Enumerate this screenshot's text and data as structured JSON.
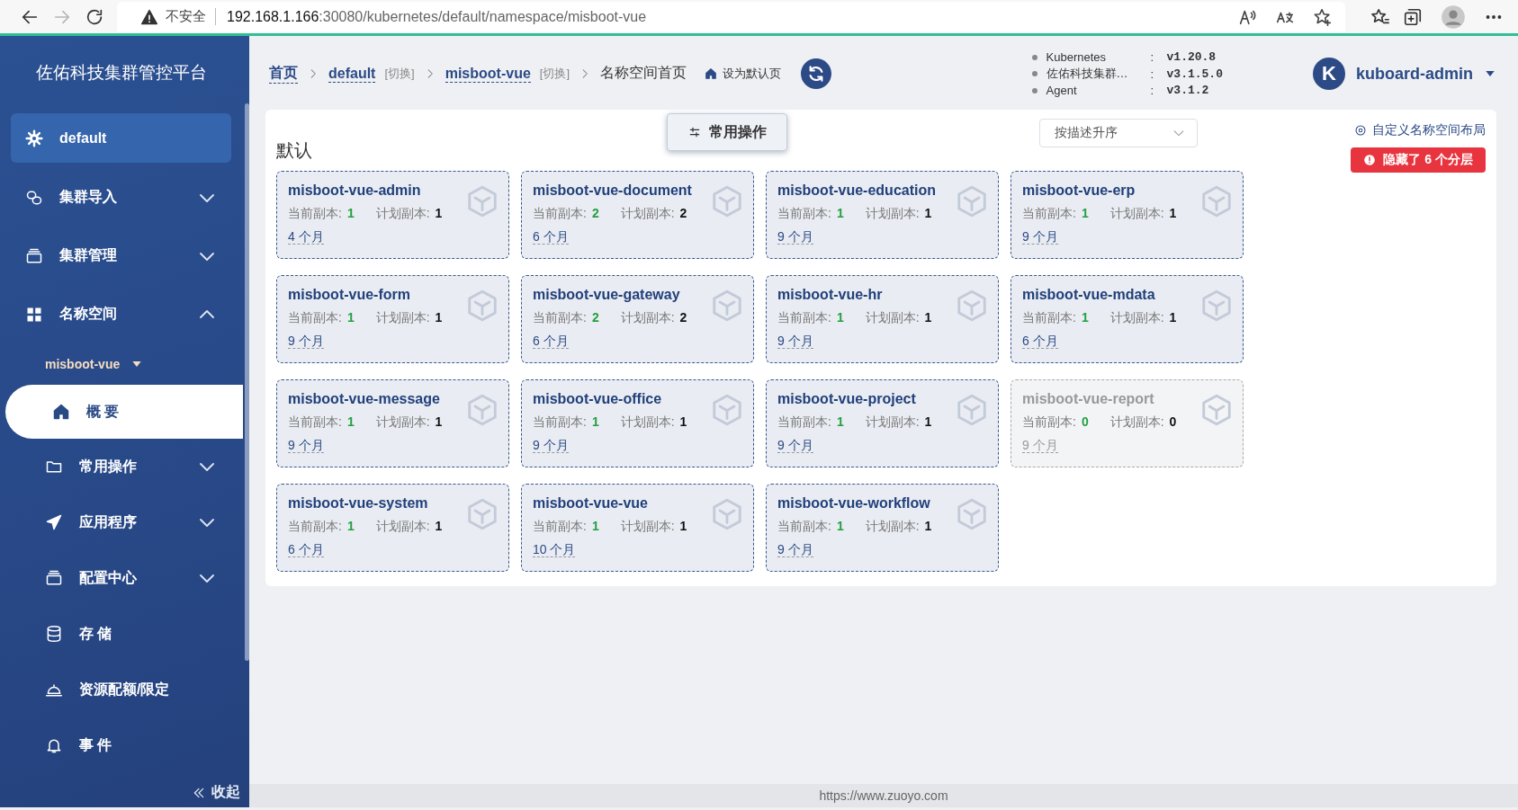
{
  "browser": {
    "security": "不安全",
    "url_host": "192.168.1.166",
    "url_rest": ":30080/kubernetes/default/namespace/misboot-vue"
  },
  "sidebar": {
    "title": "佐佑科技集群管控平台",
    "items": [
      {
        "label": "default",
        "selected": true
      },
      {
        "label": "集群导入",
        "expanded": false,
        "selected": false
      },
      {
        "label": "集群管理",
        "expanded": false,
        "selected": false
      },
      {
        "label": "名称空间",
        "expanded": true,
        "selected": false,
        "namespace": "misboot-vue",
        "children": [
          {
            "label": "概 要",
            "selected": true
          },
          {
            "label": "常用操作",
            "expanded": false,
            "selected": false
          },
          {
            "label": "应用程序",
            "expanded": false,
            "selected": false
          },
          {
            "label": "配置中心",
            "expanded": false,
            "selected": false
          },
          {
            "label": "存 储",
            "selected": false
          },
          {
            "label": "资源配额/限定",
            "selected": false
          },
          {
            "label": "事 件",
            "selected": false
          }
        ]
      }
    ],
    "collapse": "收起"
  },
  "breadcrumb": {
    "items": [
      {
        "label": "首页",
        "current": false
      },
      {
        "label": "default",
        "switch": "[切换]",
        "current": false
      },
      {
        "label": "misboot-vue",
        "switch": "[切换]",
        "current": false
      },
      {
        "label": "名称空间首页",
        "current": true
      }
    ],
    "set_default": "设为默认页"
  },
  "versions": [
    {
      "name": "Kubernetes",
      "separator": ":",
      "value": "v1.20.8"
    },
    {
      "name": "佐佑科技集群…",
      "separator": ":",
      "value": "v3.1.5.0"
    },
    {
      "name": "Agent",
      "separator": ":",
      "value": "v3.1.2"
    }
  ],
  "user": {
    "avatar": "K",
    "name": "kuboard-admin"
  },
  "content": {
    "title": "默认",
    "actions_button": "常用操作",
    "sort": "按描述升序",
    "layout_link": "自定义名称空间布局",
    "hidden_badge": "隐藏了 6 个分层",
    "workloads": [
      {
        "name": "misboot-vue-admin",
        "current_label": "当前副本:",
        "current": "1",
        "planned_label": "计划副本:",
        "planned": "1",
        "age": "4 个月",
        "active": true
      },
      {
        "name": "misboot-vue-document",
        "current_label": "当前副本:",
        "current": "2",
        "planned_label": "计划副本:",
        "planned": "2",
        "age": "6 个月",
        "active": true
      },
      {
        "name": "misboot-vue-education",
        "current_label": "当前副本:",
        "current": "1",
        "planned_label": "计划副本:",
        "planned": "1",
        "age": "9 个月",
        "active": true
      },
      {
        "name": "misboot-vue-erp",
        "current_label": "当前副本:",
        "current": "1",
        "planned_label": "计划副本:",
        "planned": "1",
        "age": "9 个月",
        "active": true
      },
      {
        "name": "misboot-vue-form",
        "current_label": "当前副本:",
        "current": "1",
        "planned_label": "计划副本:",
        "planned": "1",
        "age": "9 个月",
        "active": true
      },
      {
        "name": "misboot-vue-gateway",
        "current_label": "当前副本:",
        "current": "2",
        "planned_label": "计划副本:",
        "planned": "2",
        "age": "6 个月",
        "active": true
      },
      {
        "name": "misboot-vue-hr",
        "current_label": "当前副本:",
        "current": "1",
        "planned_label": "计划副本:",
        "planned": "1",
        "age": "9 个月",
        "active": true
      },
      {
        "name": "misboot-vue-mdata",
        "current_label": "当前副本:",
        "current": "1",
        "planned_label": "计划副本:",
        "planned": "1",
        "age": "6 个月",
        "active": true
      },
      {
        "name": "misboot-vue-message",
        "current_label": "当前副本:",
        "current": "1",
        "planned_label": "计划副本:",
        "planned": "1",
        "age": "9 个月",
        "active": true
      },
      {
        "name": "misboot-vue-office",
        "current_label": "当前副本:",
        "current": "1",
        "planned_label": "计划副本:",
        "planned": "1",
        "age": "9 个月",
        "active": true
      },
      {
        "name": "misboot-vue-project",
        "current_label": "当前副本:",
        "current": "1",
        "planned_label": "计划副本:",
        "planned": "1",
        "age": "9 个月",
        "active": true
      },
      {
        "name": "misboot-vue-report",
        "current_label": "当前副本:",
        "current": "0",
        "planned_label": "计划副本:",
        "planned": "0",
        "age": "9 个月",
        "active": false
      },
      {
        "name": "misboot-vue-system",
        "current_label": "当前副本:",
        "current": "1",
        "planned_label": "计划副本:",
        "planned": "1",
        "age": "6 个月",
        "active": true
      },
      {
        "name": "misboot-vue-vue",
        "current_label": "当前副本:",
        "current": "1",
        "planned_label": "计划副本:",
        "planned": "1",
        "age": "10 个月",
        "active": true
      },
      {
        "name": "misboot-vue-workflow",
        "current_label": "当前副本:",
        "current": "1",
        "planned_label": "计划副本:",
        "planned": "1",
        "age": "9 个月",
        "active": true
      }
    ]
  },
  "footer": "https://www.zuoyo.com"
}
